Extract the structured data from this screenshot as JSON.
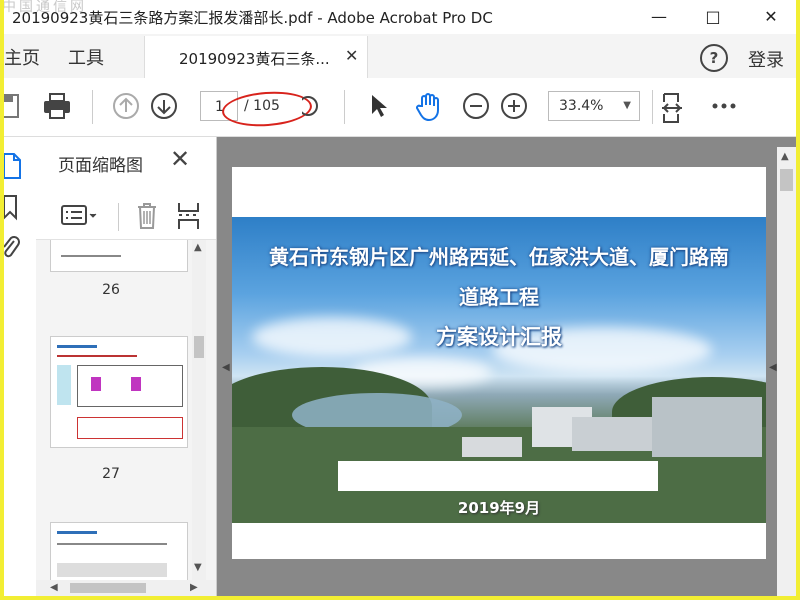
{
  "window": {
    "title": "20190923黄石三条路方案汇报发潘部长.pdf - Adobe Acrobat Pro DC",
    "watermark": "中国通信网"
  },
  "tabs": {
    "home": "主页",
    "tools": "工具",
    "doc_tab": "20190923黄石三条...",
    "login": "登录"
  },
  "toolbar": {
    "current_page": "1",
    "page_total": "/ 105",
    "zoom": "33.4%"
  },
  "panel": {
    "title": "页面缩略图",
    "thumbs": [
      {
        "number": "26"
      },
      {
        "number": "27"
      }
    ]
  },
  "document": {
    "title_line1": "黄石市东钢片区广州路西延、伍家洪大道、厦门路南",
    "title_line2": "道路工程",
    "title_line3": "方案设计汇报",
    "date": "2019年9月"
  },
  "colors": {
    "annotation_oval": "#d8231c",
    "accent_blue": "#1473e6",
    "doc_background": "#888888"
  }
}
